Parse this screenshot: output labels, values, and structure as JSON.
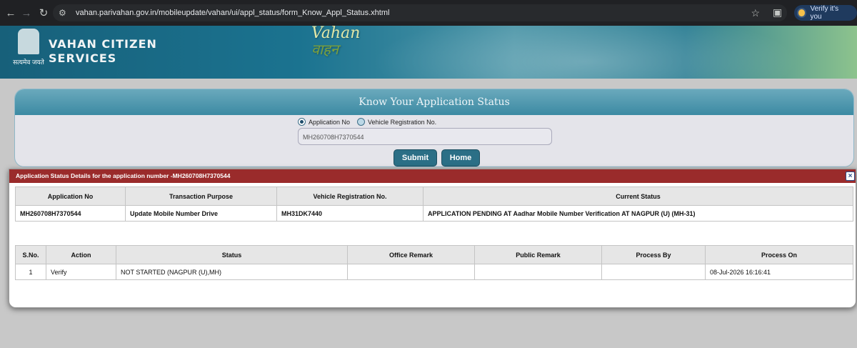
{
  "browser": {
    "url": "vahan.parivahan.gov.in/mobileupdate/vahan/ui/appl_status/form_Know_Appl_Status.xhtml",
    "verify_label": "Verify it's you"
  },
  "header": {
    "emblem_motto": "सत्यमेव जयते",
    "brand_line1": "VAHAN CITIZEN",
    "brand_line2": "SERVICES",
    "logo_en": "Vahan",
    "logo_hi": "वाहन"
  },
  "status_form": {
    "title": "Know Your Application Status",
    "radio_application": "Application No",
    "radio_vehicle": "Vehicle Registration No.",
    "application_value": "MH260708H7370544",
    "submit_label": "Submit",
    "home_label": "Home"
  },
  "dialog": {
    "title": "Application Status Details for the application number -MH260708H7370544",
    "summary_headers": [
      "Application No",
      "Transaction Purpose",
      "Vehicle Registration No.",
      "Current Status"
    ],
    "summary_row": [
      "MH260708H7370544",
      "Update Mobile Number Drive",
      "MH31DK7440",
      "APPLICATION PENDING AT Aadhar Mobile Number Verification AT NAGPUR (U) (MH-31)"
    ],
    "detail_headers": [
      "S.No.",
      "Action",
      "Status",
      "Office Remark",
      "Public Remark",
      "Process By",
      "Process On"
    ],
    "detail_row": [
      "1",
      "Verify",
      "NOT STARTED (NAGPUR (U),MH)",
      "",
      "",
      "",
      "08-Jul-2026 16:16:41"
    ]
  },
  "colors": {
    "header_teal": "#1b7390",
    "dialog_bar": "#9a2b2b",
    "button": "#2b6f86"
  }
}
